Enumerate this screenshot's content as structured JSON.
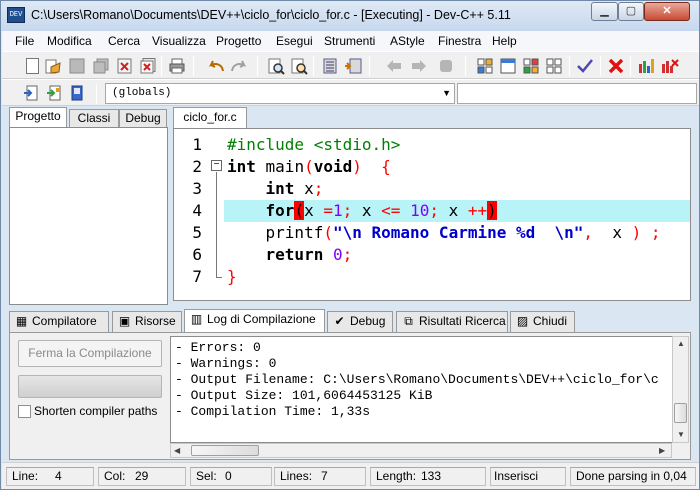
{
  "window": {
    "title": "C:\\Users\\Romano\\Documents\\DEV++\\ciclo_for\\ciclo_for.c - [Executing] - Dev-C++ 5.11",
    "app_icon_text": "DEV",
    "controls": {
      "minimize": "▁",
      "maximize": "▢",
      "close": "✕"
    }
  },
  "menu": [
    "File",
    "Modifica",
    "Cerca",
    "Visualizza",
    "Progetto",
    "Esegui",
    "Strumenti",
    "AStyle",
    "Finestra",
    "Help"
  ],
  "toolbar": {
    "icons": [
      "new-file-icon",
      "open-file-icon",
      "save-icon",
      "save-all-icon",
      "close-file-icon",
      "close-all-icon",
      "print-icon",
      "undo-icon",
      "redo-icon",
      "find-icon",
      "replace-icon",
      "indent-icon",
      "unindent-icon",
      "bookmark-back-icon",
      "bookmark-forward-icon",
      "toggle-comment-icon",
      "compile-icon",
      "run-icon",
      "compile-run-icon",
      "rebuild-icon",
      "syntax-check-icon",
      "stop-icon",
      "chart-icon",
      "profile-icon"
    ]
  },
  "toolbar2": {
    "scope_combo_value": "(globals)",
    "combo_arrow": "▼"
  },
  "left_tabs": [
    "Progetto",
    "Classi",
    "Debug"
  ],
  "editor": {
    "tab_label": "ciclo_for.c",
    "fold_minus": "−",
    "lines": [
      {
        "n": "1",
        "parts": [
          {
            "t": "#include <stdio.h>",
            "c": "pp"
          }
        ]
      },
      {
        "n": "2",
        "parts": [
          {
            "t": "int",
            "c": "kw"
          },
          {
            "t": " main",
            "c": ""
          },
          {
            "t": "(",
            "c": "sym"
          },
          {
            "t": "void",
            "c": "kw"
          },
          {
            "t": ")",
            "c": "sym"
          },
          {
            "t": "  ",
            "c": ""
          },
          {
            "t": "{",
            "c": "sym"
          }
        ]
      },
      {
        "n": "3",
        "parts": [
          {
            "t": "    ",
            "c": ""
          },
          {
            "t": "int",
            "c": "kw"
          },
          {
            "t": " x",
            "c": ""
          },
          {
            "t": ";",
            "c": "sym"
          }
        ]
      },
      {
        "n": "4",
        "parts": [
          {
            "t": "    ",
            "c": ""
          },
          {
            "t": "for",
            "c": "kw"
          },
          {
            "t": "(",
            "c": "brk"
          },
          {
            "t": "x ",
            "c": ""
          },
          {
            "t": "=",
            "c": "sym"
          },
          {
            "t": "1",
            "c": "num"
          },
          {
            "t": ";",
            "c": "sym"
          },
          {
            "t": " x ",
            "c": ""
          },
          {
            "t": "<=",
            "c": "sym"
          },
          {
            "t": " ",
            "c": ""
          },
          {
            "t": "10",
            "c": "num"
          },
          {
            "t": ";",
            "c": "sym"
          },
          {
            "t": " x ",
            "c": ""
          },
          {
            "t": "++",
            "c": "sym"
          },
          {
            "t": ")",
            "c": "brk"
          }
        ]
      },
      {
        "n": "5",
        "parts": [
          {
            "t": "    printf",
            "c": ""
          },
          {
            "t": "(",
            "c": "sym"
          },
          {
            "t": "\"\\n Romano Carmine %d  \\n\"",
            "c": "str"
          },
          {
            "t": ",",
            "c": "sym"
          },
          {
            "t": "  x ",
            "c": ""
          },
          {
            "t": ")",
            "c": "sym"
          },
          {
            "t": " ;",
            "c": "sym"
          }
        ]
      },
      {
        "n": "6",
        "parts": [
          {
            "t": "    ",
            "c": ""
          },
          {
            "t": "return",
            "c": "kw"
          },
          {
            "t": " ",
            "c": ""
          },
          {
            "t": "0",
            "c": "num"
          },
          {
            "t": ";",
            "c": "sym"
          }
        ]
      },
      {
        "n": "7",
        "parts": [
          {
            "t": "}",
            "c": "sym"
          }
        ]
      }
    ],
    "highlight_line": 4
  },
  "bottom_tabs": [
    {
      "label": "Compilatore",
      "icon": "compiler-icon",
      "glyph": "▦"
    },
    {
      "label": "Risorse",
      "icon": "resources-icon",
      "glyph": "▣"
    },
    {
      "label": "Log di Compilazione",
      "icon": "log-chart-icon",
      "glyph": "▥"
    },
    {
      "label": "Debug",
      "icon": "debug-check-icon",
      "glyph": "✔"
    },
    {
      "label": "Risultati Ricerca",
      "icon": "search-results-icon",
      "glyph": "⧉"
    },
    {
      "label": "Chiudi",
      "icon": "close-panel-icon",
      "glyph": "▨"
    }
  ],
  "compile_panel": {
    "stop_button": "Ferma la Compilazione",
    "shorten_label": "Shorten compiler paths",
    "log_lines": [
      "- Errors: 0",
      "- Warnings: 0",
      "- Output Filename: C:\\Users\\Romano\\Documents\\DEV++\\ciclo_for\\c",
      "- Output Size: 101,6064453125 KiB",
      "- Compilation Time: 1,33s"
    ]
  },
  "scroll_arrows": {
    "up": "▲",
    "down": "▼",
    "left": "◀",
    "right": "▶"
  },
  "status": {
    "line_label": "Line:",
    "line_value": "4",
    "col_label": "Col:",
    "col_value": "29",
    "sel_label": "Sel:",
    "sel_value": "0",
    "lines_label": "Lines:",
    "lines_value": "7",
    "length_label": "Length:",
    "length_value": "133",
    "mode": "Inserisci",
    "parse": "Done parsing in 0,04"
  },
  "colors": {
    "keyword": "#000000",
    "preprocessor": "#008000",
    "string": "#0000cc",
    "number": "#8000ff",
    "symbol": "#ff0000",
    "current_line": "#b8f3f7",
    "bracket_match": "#ff0000"
  }
}
